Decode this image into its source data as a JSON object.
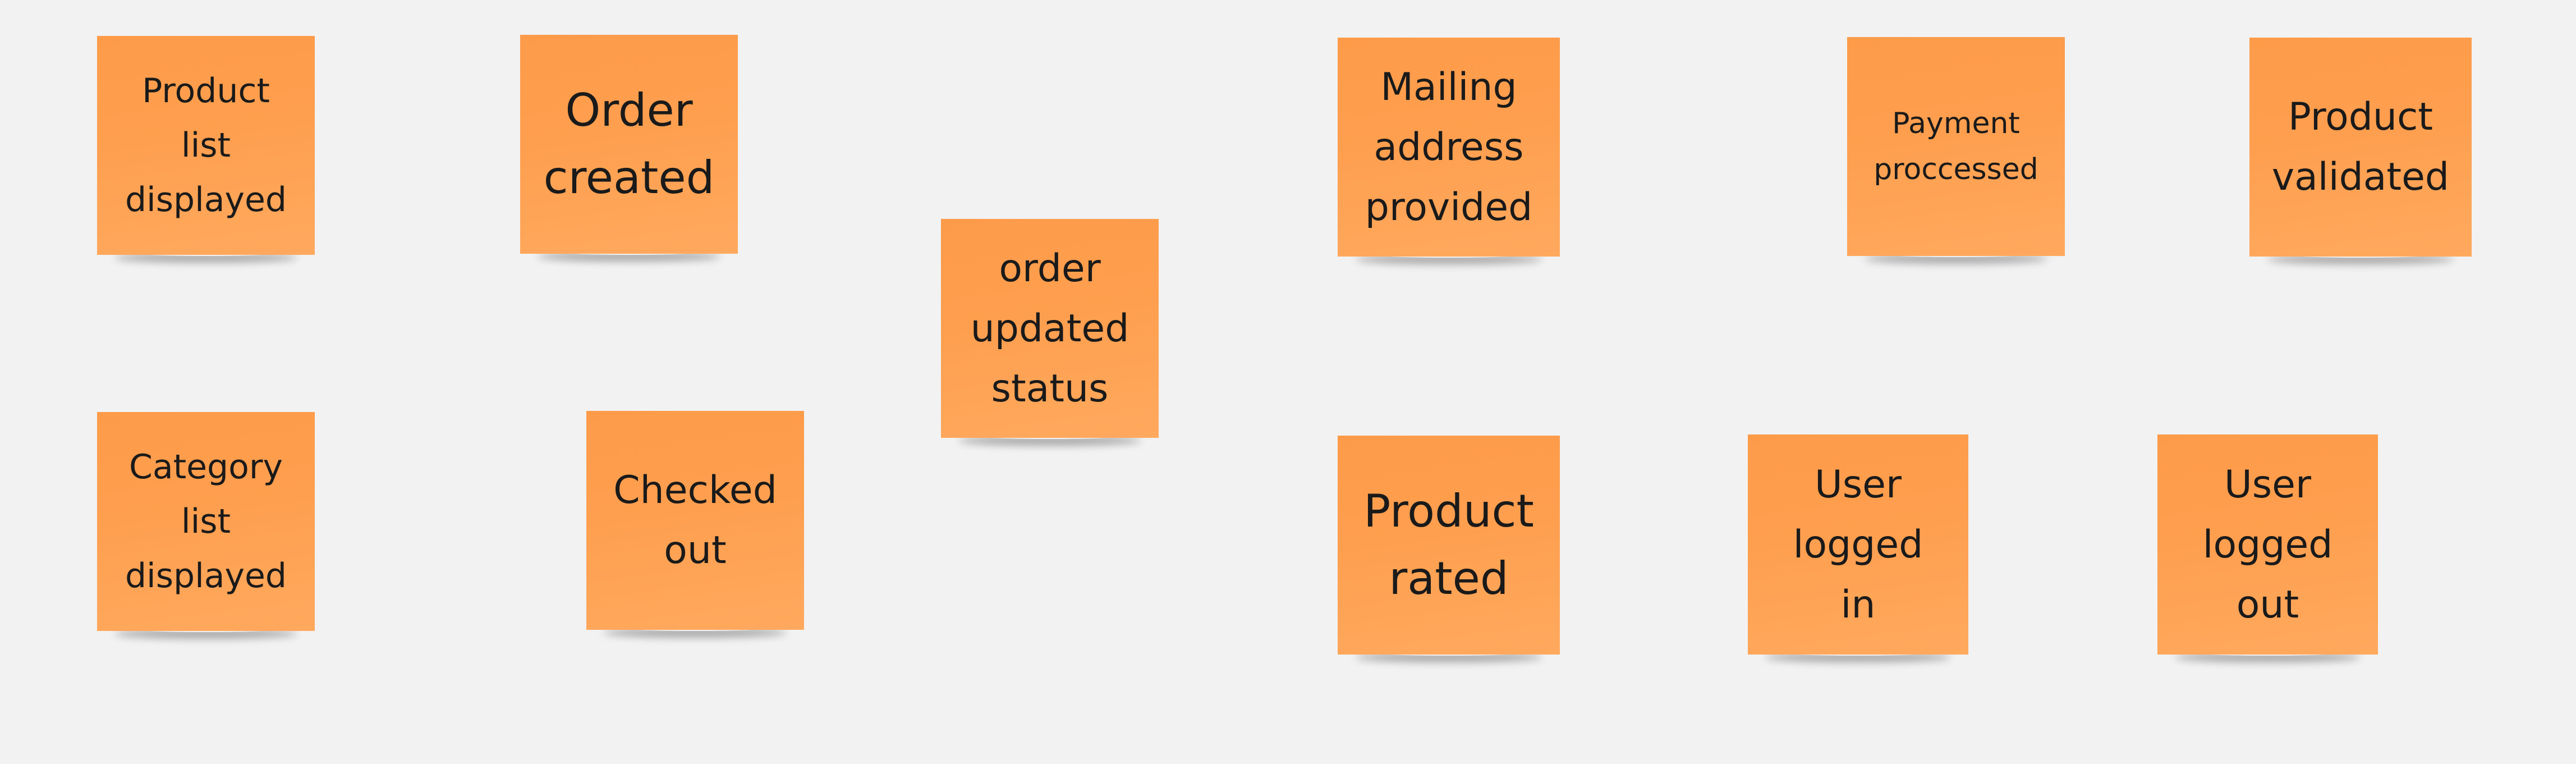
{
  "board": {
    "background_color": "#f2f2f2",
    "sticky_color": "#fe9f4f",
    "text_color": "#1a1a1a"
  },
  "stickies": [
    {
      "id": "product-list-displayed",
      "text": "Product\nlist\ndisplayed"
    },
    {
      "id": "order-created",
      "text": "Order\ncreated"
    },
    {
      "id": "order-updated-status",
      "text": "order\nupdated\nstatus"
    },
    {
      "id": "mailing-address-provided",
      "text": "Mailing\naddress\nprovided"
    },
    {
      "id": "payment-processed",
      "text": "Payment\nproccessed"
    },
    {
      "id": "product-validated",
      "text": "Product\nvalidated"
    },
    {
      "id": "category-list-displayed",
      "text": "Category\nlist\ndisplayed"
    },
    {
      "id": "checked-out",
      "text": "Checked\nout"
    },
    {
      "id": "product-rated",
      "text": "Product\nrated"
    },
    {
      "id": "user-logged-in",
      "text": "User\nlogged\nin"
    },
    {
      "id": "user-logged-out",
      "text": "User\nlogged\nout"
    }
  ]
}
